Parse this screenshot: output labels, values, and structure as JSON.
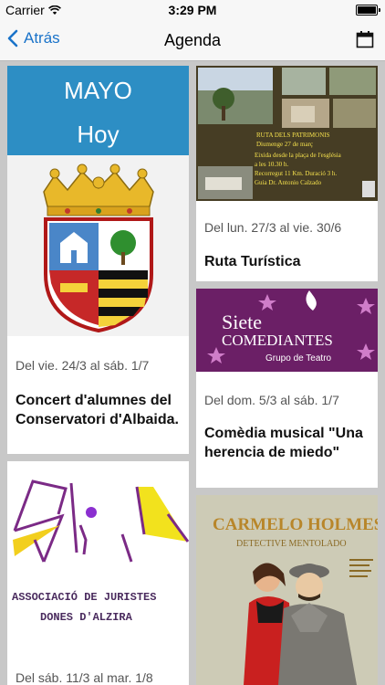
{
  "status": {
    "carrier": "Carrier",
    "time": "3:29 PM"
  },
  "nav": {
    "back_label": "Atrás",
    "title": "Agenda"
  },
  "highlight": {
    "month": "MAYO",
    "today": "Hoy"
  },
  "events": [
    {
      "date": "Del vie. 24/3 al sáb. 1/7",
      "title": "Concert d'alumnes del Conservatori d'Albaida."
    },
    {
      "date": "Del lun. 27/3 al vie. 30/6",
      "title": "Ruta Turística"
    },
    {
      "date": "Del dom. 5/3 al sáb. 1/7",
      "title": "Comèdia musical \"Una herencia de miedo\""
    },
    {
      "date": "Del sáb. 11/3 al mar. 1/8",
      "title": ""
    }
  ],
  "posters": {
    "siete": {
      "line1": "Siete",
      "line2": "COMEDIANTES",
      "line3": "Grupo de Teatro"
    },
    "juristes": {
      "line1": "ASSOCIACIÓ DE JURISTES",
      "line2": "DONES D'ALZIRA"
    },
    "carmelo": {
      "line1": "CARMELO HOLMES",
      "line2": "DETECTIVE MENTOLADO"
    },
    "ruta": {
      "line1": "RUTA DELS PATRIMONIS",
      "line2": "Diumenge 27 de març",
      "line3": "Eixida desde la plaça de l'església",
      "line4": "a les 10.30 h.",
      "line5": "Recorregut 11 Km. Duració 3 h.",
      "line6": "Guia Dr. Antonio Calzado"
    }
  },
  "colors": {
    "accent": "#1a73c9",
    "highlight_bg": "#2d8ec4",
    "siete_bg": "#6b1f66"
  }
}
